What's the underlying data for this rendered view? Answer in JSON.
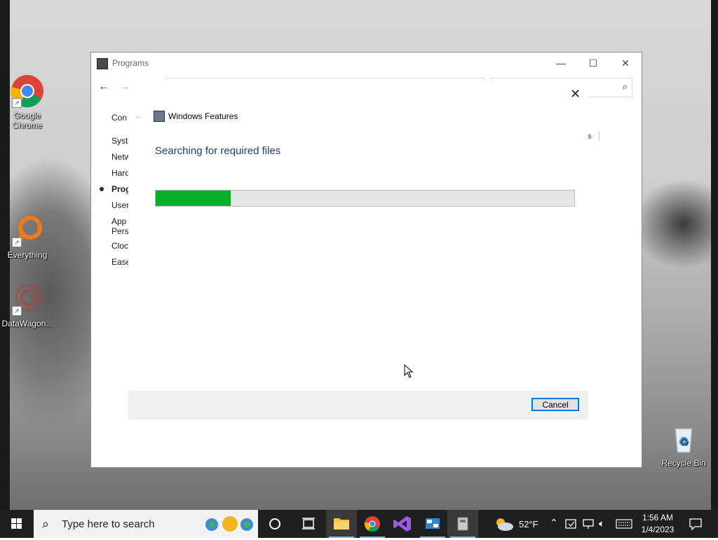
{
  "desktop": {
    "icons": [
      {
        "label": "Google Chrome"
      },
      {
        "label": "Everything"
      },
      {
        "label": "DataWagon..."
      },
      {
        "label": "Recycle Bin"
      }
    ]
  },
  "programs_window": {
    "title": "Programs",
    "nav": [
      "Con",
      "Syste",
      "Netw",
      "Hard",
      "Prog",
      "User",
      "App Pers",
      "Clock",
      "Ease"
    ],
    "active_nav": "Prog",
    "addr_fragment": "s"
  },
  "features_dialog": {
    "title": "Windows Features",
    "heading": "Searching for required files",
    "progress_fraction": 0.18,
    "cancel_label": "Cancel",
    "close_glyph": "✕",
    "back_glyph": "←"
  },
  "taskbar": {
    "search_placeholder": "Type here to search",
    "weather_temp": "52°F",
    "clock_time": "1:56 AM",
    "clock_date": "1/4/2023"
  },
  "colors": {
    "progress_fill": "#06b025",
    "heading": "#1f3d7a",
    "focus_border": "#0078d7"
  }
}
